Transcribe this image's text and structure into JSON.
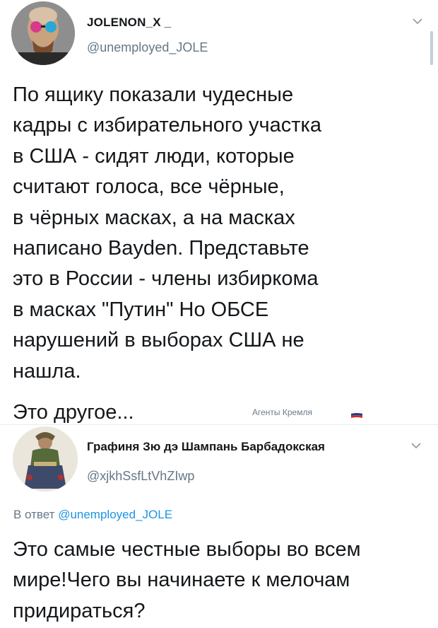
{
  "tweet": {
    "display_name": "JOLENON_X _",
    "handle": "@unemployed_JOLE",
    "text": "По ящику показали чудесные\nкадры с избирательного участка\nв США - сидят люди, которые\nсчитают голоса, все чёрные,\nв чёрных масках, а на масках\nнаписано Bayden. Представьте\nэто в России - члены избиркома\nв масках \"Путин\" Но ОБСЕ\nнарушений в выборах США не\nнашла.",
    "tail": "Это другое...",
    "avatar_icon": "avatar-portrait-icon",
    "menu_icon": "chevron-down-icon"
  },
  "watermark": {
    "text": "Агенты Кремля",
    "flag_icon": "russian-flag-icon",
    "flag_colors": [
      "#ffffff",
      "#1c3f94",
      "#d52b1e"
    ]
  },
  "reply": {
    "display_name": "Графиня Зю дэ Шампань Барбадокская",
    "handle": "@xjkhSsfLtVhZIwp",
    "reply_prefix": "В ответ",
    "reply_mention": "@unemployed_JOLE",
    "text": "Это самые честные выборы во всем мире!Чего вы начинаете к мелочам придираться?",
    "avatar_icon": "avatar-portrait-icon",
    "menu_icon": "chevron-down-icon"
  },
  "colors": {
    "text": "#14171a",
    "secondary": "#657786",
    "link": "#1b95e0",
    "divider": "#e6ecf0"
  }
}
